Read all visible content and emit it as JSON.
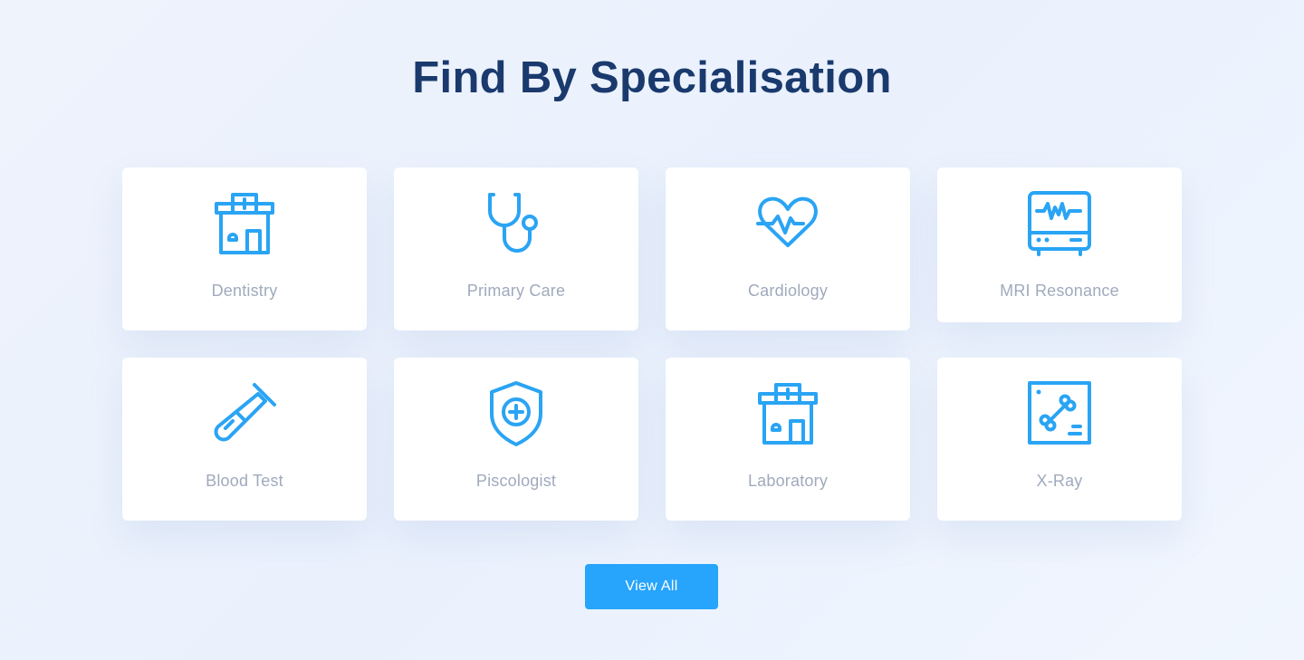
{
  "page": {
    "title": "Find By Specialisation",
    "accent_color": "#27a4fb",
    "title_color": "#1a3a6e"
  },
  "specialisations": [
    {
      "label": "Dentistry",
      "icon": "hospital-icon"
    },
    {
      "label": "Primary Care",
      "icon": "stethoscope-icon"
    },
    {
      "label": "Cardiology",
      "icon": "heartbeat-icon"
    },
    {
      "label": "MRI Resonance",
      "icon": "monitor-icon"
    },
    {
      "label": "Blood Test",
      "icon": "test-tube-icon"
    },
    {
      "label": "Piscologist",
      "icon": "shield-plus-icon"
    },
    {
      "label": "Laboratory",
      "icon": "hospital-icon"
    },
    {
      "label": "X-Ray",
      "icon": "xray-bone-icon"
    }
  ],
  "actions": {
    "view_all_label": "View All"
  }
}
